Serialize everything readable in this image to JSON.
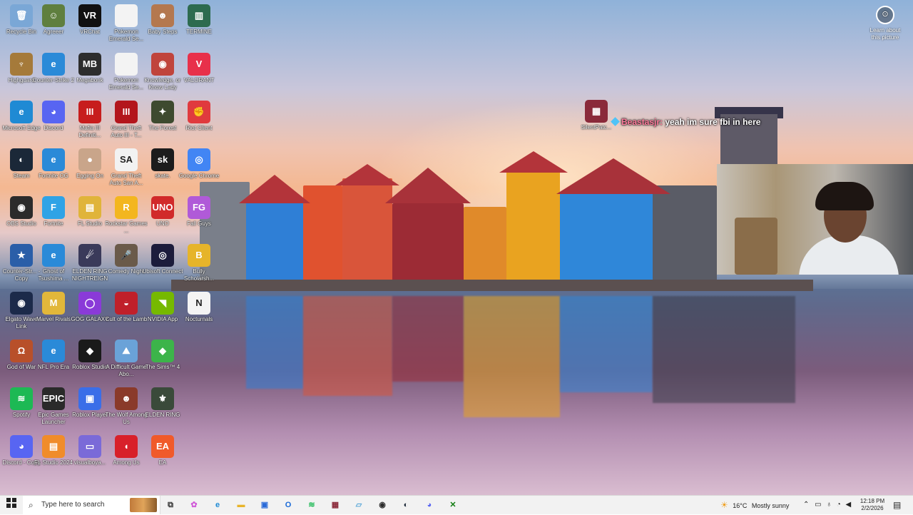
{
  "desktop": {
    "icons": [
      {
        "label": "Recycle Bin",
        "glyph": "🗑",
        "color": "#7aa7d6",
        "badge": false
      },
      {
        "label": "Agreeer",
        "glyph": "☺",
        "color": "#5f7f3f",
        "badge": false
      },
      {
        "label": "VRChat",
        "glyph": "VR",
        "color": "#111111",
        "badge": false
      },
      {
        "label": "Pokemon Emerald Se...",
        "glyph": "",
        "color": "#f3f3f3",
        "badge": false
      },
      {
        "label": "Baby Steps",
        "glyph": "☻",
        "color": "#b4784f",
        "badge": false
      },
      {
        "label": "TERMINE",
        "glyph": "▥",
        "color": "#2d6b4f",
        "badge": false
      },
      {
        "label": "Highguard",
        "glyph": "♆",
        "color": "#a57a3a",
        "badge": false
      },
      {
        "label": "Counter-Strike 2",
        "glyph": "e",
        "color": "#2a8ad8",
        "badge": false
      },
      {
        "label": "Megabonk",
        "glyph": "MB",
        "color": "#2d2d2d",
        "badge": false
      },
      {
        "label": "Pokemon Emerald Se...",
        "glyph": "",
        "color": "#f3f3f3",
        "badge": false
      },
      {
        "label": "Knowledge, or Know Lady",
        "glyph": "◉",
        "color": "#c0443c",
        "badge": false
      },
      {
        "label": "VALORANT",
        "glyph": "V",
        "color": "#e8304a",
        "badge": false
      },
      {
        "label": "Microsoft Edge",
        "glyph": "e",
        "color": "#1f8ad4",
        "badge": false
      },
      {
        "label": "Discord",
        "glyph": "◕",
        "color": "#5865f2",
        "badge": false
      },
      {
        "label": "Mafia III Definiti...",
        "glyph": "III",
        "color": "#c71d1d",
        "badge": false
      },
      {
        "label": "Grand Theft Auto III - T...",
        "glyph": "III",
        "color": "#b3161c",
        "badge": false
      },
      {
        "label": "The Forest",
        "glyph": "✦",
        "color": "#3e4a2f",
        "badge": false
      },
      {
        "label": "Riot Client",
        "glyph": "✊",
        "color": "#e03a3e",
        "badge": false
      },
      {
        "label": "Steam",
        "glyph": "◐",
        "color": "#1b2838",
        "badge": false
      },
      {
        "label": "Fortnite OG",
        "glyph": "e",
        "color": "#2a8ad8",
        "badge": false
      },
      {
        "label": "Egging On",
        "glyph": "●",
        "color": "#c9a58a",
        "badge": false
      },
      {
        "label": "Grand Theft Auto San A...",
        "glyph": "SA",
        "color": "#f2f2f2",
        "badge": false
      },
      {
        "label": "skate.",
        "glyph": "sk",
        "color": "#1c1c1c",
        "badge": false
      },
      {
        "label": "Google Chrome",
        "glyph": "◎",
        "color": "#4285f4",
        "badge": false
      },
      {
        "label": "OBS Studio",
        "glyph": "◉",
        "color": "#2b2b2b",
        "badge": false
      },
      {
        "label": "Fortnite",
        "glyph": "F",
        "color": "#2fa3e6",
        "badge": false
      },
      {
        "label": "FL Studio",
        "glyph": "▤",
        "color": "#e0b43a",
        "badge": false
      },
      {
        "label": "Rockstar Games ...",
        "glyph": "R",
        "color": "#f3b61f",
        "badge": false
      },
      {
        "label": "UNO",
        "glyph": "UNO",
        "color": "#d12a2a",
        "badge": false
      },
      {
        "label": "Fall Guys",
        "glyph": "FG",
        "color": "#b05ad8",
        "badge": false
      },
      {
        "label": "Counter-Str... - Copy",
        "glyph": "★",
        "color": "#2a5ea8",
        "badge": false
      },
      {
        "label": "Ghost of Tsushima ...",
        "glyph": "e",
        "color": "#2a8ad8",
        "badge": false
      },
      {
        "label": "ELDEN RING NIGHTREIGN",
        "glyph": "☄",
        "color": "#3a3a5a",
        "badge": false
      },
      {
        "label": "Comedy Night",
        "glyph": "🎤",
        "color": "#6a5a4a",
        "badge": false
      },
      {
        "label": "Ubisoft Connect",
        "glyph": "◎",
        "color": "#1c1c3c",
        "badge": false
      },
      {
        "label": "Bully Scholarsh...",
        "glyph": "B",
        "color": "#e6b42a",
        "badge": false
      },
      {
        "label": "Elgato Wave Link",
        "glyph": "◉",
        "color": "#1c2a4a",
        "badge": false
      },
      {
        "label": "Marvel Rivals",
        "glyph": "M",
        "color": "#e2b73a",
        "badge": false
      },
      {
        "label": "GOG GALAXY",
        "glyph": "◯",
        "color": "#8a3ad8",
        "badge": false
      },
      {
        "label": "Cult of the Lamb",
        "glyph": "◒",
        "color": "#c0202a",
        "badge": false
      },
      {
        "label": "NVIDIA App",
        "glyph": "◥",
        "color": "#76b900",
        "badge": false
      },
      {
        "label": "Nocturnals",
        "glyph": "N",
        "color": "#f4f4f4",
        "badge": false
      },
      {
        "label": "God of War",
        "glyph": "Ω",
        "color": "#b8502a",
        "badge": false
      },
      {
        "label": "NFL Pro Era",
        "glyph": "e",
        "color": "#2a8ad8",
        "badge": false
      },
      {
        "label": "Roblox Studio",
        "glyph": "◆",
        "color": "#1a1a1a",
        "badge": false
      },
      {
        "label": "A Difficult Game Abo...",
        "glyph": "⛰",
        "color": "#6aa2d8",
        "badge": false
      },
      {
        "label": "The Sims™ 4",
        "glyph": "◆",
        "color": "#3cb44a",
        "badge": false
      },
      {
        "label": "Spotify",
        "glyph": "≋",
        "color": "#1db954",
        "badge": false
      },
      {
        "label": "Epic Games Launcher",
        "glyph": "EPIC",
        "color": "#2a2a2a",
        "badge": false
      },
      {
        "label": "Roblox Player",
        "glyph": "▣",
        "color": "#3a6ee8",
        "badge": false
      },
      {
        "label": "The Wolf Among Us",
        "glyph": "☻",
        "color": "#8a3a2a",
        "badge": false
      },
      {
        "label": "ELDEN RING",
        "glyph": "⚜",
        "color": "#3a4a3a",
        "badge": false
      },
      {
        "label": "Discord - Copy",
        "glyph": "◕",
        "color": "#5865f2",
        "badge": false
      },
      {
        "label": "FL Studio 2024",
        "glyph": "▤",
        "color": "#f08c2a",
        "badge": false
      },
      {
        "label": "visualboya...",
        "glyph": "▭",
        "color": "#7a6ad8",
        "badge": false
      },
      {
        "label": "Among Us",
        "glyph": "◖",
        "color": "#d8202a",
        "badge": false
      },
      {
        "label": "EA",
        "glyph": "EA",
        "color": "#f05a2a",
        "badge": false
      },
      {
        "label": "SilentPatc...",
        "glyph": "▦",
        "color": "#8a2a3a",
        "badge": false
      }
    ],
    "learn_about": {
      "label": "Learn about this picture",
      "glyph": "⊙"
    },
    "overlay_chat": {
      "user": "Beastasjr:",
      "message": "yeah im sure fbi in here"
    }
  },
  "taskbar": {
    "start_icon": "windows-icon",
    "search_placeholder": "Type here to search",
    "buttons": [
      {
        "name": "task-view",
        "glyph": "⧉",
        "color": "#333333"
      },
      {
        "name": "copilot",
        "glyph": "✿",
        "color": "#d05ad8"
      },
      {
        "name": "edge",
        "glyph": "e",
        "color": "#1f8ad4"
      },
      {
        "name": "file-explorer",
        "glyph": "▬",
        "color": "#e8b42a"
      },
      {
        "name": "store",
        "glyph": "▣",
        "color": "#2a6ad8"
      },
      {
        "name": "outlook",
        "glyph": "O",
        "color": "#1a6ad8"
      },
      {
        "name": "spotify",
        "glyph": "≋",
        "color": "#1db954"
      },
      {
        "name": "winrar",
        "glyph": "▦",
        "color": "#8a2a3a"
      },
      {
        "name": "notepad",
        "glyph": "▱",
        "color": "#5aa8d8"
      },
      {
        "name": "obs",
        "glyph": "◉",
        "color": "#2b2b2b"
      },
      {
        "name": "steam",
        "glyph": "◐",
        "color": "#1b2838"
      },
      {
        "name": "discord",
        "glyph": "◕",
        "color": "#5865f2"
      },
      {
        "name": "xbox",
        "glyph": "✕",
        "color": "#107c10"
      }
    ],
    "weather": {
      "temp": "16°C",
      "desc": "Mostly sunny"
    },
    "clock": {
      "time": "12:18 PM",
      "date": "2/2/2026"
    }
  },
  "colors": {
    "taskbar_bg": "#f2f2f2",
    "chat_user": "#ff7b9c"
  }
}
